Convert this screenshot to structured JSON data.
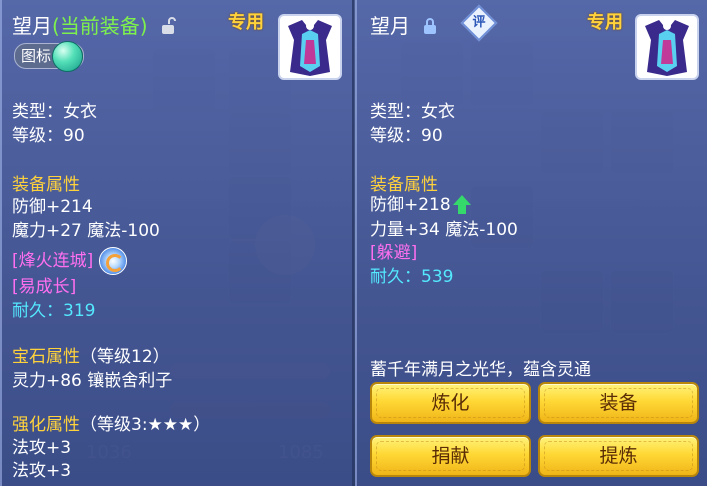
{
  "left_panel": {
    "name": "望月",
    "equipped_label": "(当前装备)",
    "exclusive_label": "专用",
    "icon_tag_label": "图标",
    "type_line": "类型：女衣",
    "level_line": "等级：90",
    "equip_attr_header": "装备属性",
    "defense_line": "防御+214",
    "magic_line": "魔力+27 魔法-100",
    "special_effect": "[烽火连城]",
    "special_effect_2": "[易成长]",
    "durability_label": "耐久：",
    "durability_value": "319",
    "gem_header": "宝石属性",
    "gem_level": "（等级12）",
    "gem_line": "灵力+86 镶嵌舍利子",
    "enhance_header": "强化属性",
    "enhance_level": "（等级3:★★★）",
    "enhance_line_1": "法攻+3",
    "enhance_line_2": "法攻+3"
  },
  "right_panel": {
    "name": "望月",
    "review_badge": "评",
    "exclusive_label": "专用",
    "type_line": "类型：女衣",
    "level_line": "等级：90",
    "equip_attr_header": "装备属性",
    "defense_line": "防御+218",
    "strength_line": "力量+34 魔法-100",
    "special_effect": "[躲避]",
    "durability_label": "耐久：",
    "durability_value": "539",
    "description": "蓄千年满月之光华，蕴含灵通",
    "buttons": {
      "refine": "炼化",
      "equip": "装备",
      "donate": "捐献",
      "extract": "提炼"
    }
  },
  "background": {
    "bg_num_1": "1036",
    "bg_num_2": "1085"
  },
  "colors": {
    "gold": "#ffd23c",
    "green": "#7ef24c",
    "pink": "#ff6ff0",
    "cyan": "#54e9ff",
    "button": "#ffd836"
  }
}
